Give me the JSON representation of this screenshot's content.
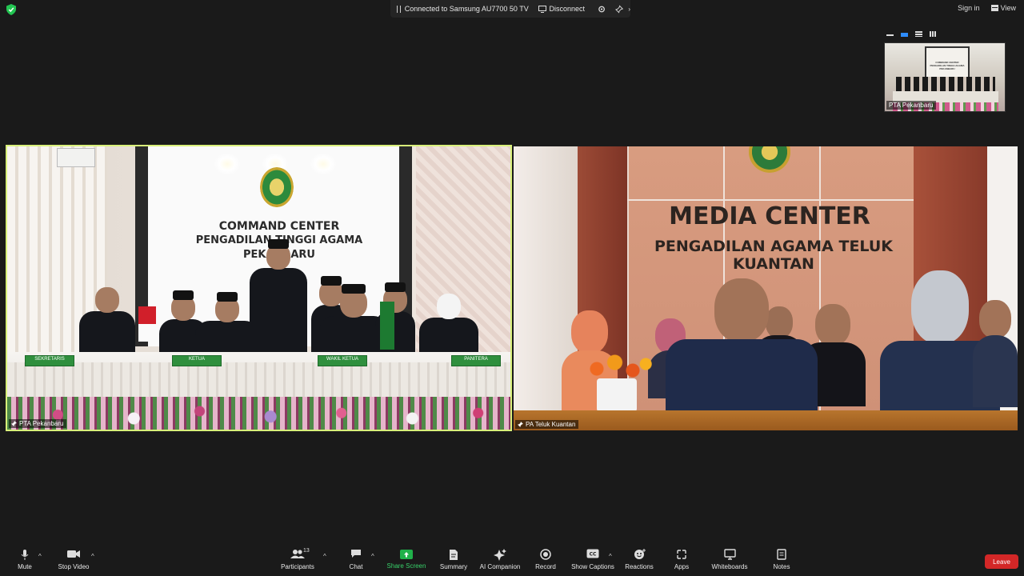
{
  "top_bar": {
    "connection_text": "Connected to Samsung AU7700 50 TV",
    "disconnect_label": "Disconnect",
    "sign_in_label": "Sign in",
    "view_label": "View",
    "security_color": "#23c552"
  },
  "self_view": {
    "name": "PTA Pekanbaru",
    "sign_line1": "COMMAND CENTER",
    "sign_line2": "PENGADILAN TINGGI AGAMA",
    "sign_line3": "PEKANBARU"
  },
  "tiles": [
    {
      "name": "PTA Pekanbaru",
      "active_speaker": true,
      "sign_line1": "COMMAND CENTER",
      "sign_line2": "PENGADILAN TINGGI AGAMA",
      "sign_line3": "PEKANBARU",
      "nameplates": [
        "SEKRETARIS",
        "KETUA",
        "WAKIL KETUA",
        "PANITERA"
      ]
    },
    {
      "name": "PA Teluk Kuantan",
      "active_speaker": false,
      "sign_line1": "MEDIA CENTER",
      "sign_line2": "PENGADILAN AGAMA TELUK KUANTAN"
    }
  ],
  "toolbar": {
    "mute": "Mute",
    "stop_video": "Stop Video",
    "participants": "Participants",
    "participant_count": "13",
    "chat": "Chat",
    "share_screen": "Share Screen",
    "summary": "Summary",
    "ai_companion": "AI Companion",
    "record": "Record",
    "show_captions": "Show Captions",
    "reactions": "Reactions",
    "apps": "Apps",
    "whiteboards": "Whiteboards",
    "notes": "Notes",
    "leave": "Leave"
  },
  "colors": {
    "background": "#1a1a1a",
    "active_speaker_border": "#d8f07a",
    "share_green": "#20b14a",
    "leave_red": "#d32727"
  }
}
